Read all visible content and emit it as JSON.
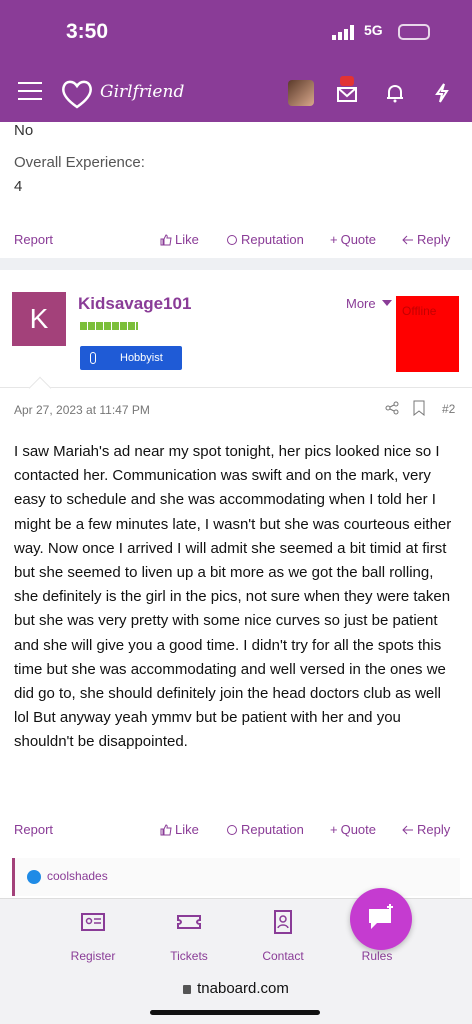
{
  "status": {
    "time": "3:50",
    "network": "5G"
  },
  "header": {
    "brand": "Girlfriend"
  },
  "prev_post": {
    "answer": "No",
    "question": "Overall Experience:",
    "rating": "4",
    "report": "Report",
    "like": "Like",
    "reputation": "Reputation",
    "quote": "Quote",
    "reply": "Reply"
  },
  "post": {
    "avatar_letter": "K",
    "username": "Kidsavage101",
    "badge": "Hobbyist",
    "more": "More",
    "status": "Offline",
    "date": "Apr 27, 2023 at 11:47 PM",
    "number": "#2",
    "body": "I saw Mariah's ad near my spot tonight, her pics looked nice so I contacted her. Communication was swift and on the mark, very easy to schedule and she was accommodating when I told her I might be a few minutes late, I wasn't but she was courteous either way. Now once I arrived I will admit she seemed a bit timid at first but she seemed to liven up a bit more as we got the ball rolling, she definitely is the girl in the pics, not sure when they were taken but she was very pretty with some nice curves so just be patient and she will give you a good time. I didn't try for all the spots this time but she was accommodating and well versed in the ones we did go to, she should definitely join the head doctors club as well lol But anyway yeah ymmv but be patient with her and you shouldn't be disappointed.",
    "report": "Report",
    "like": "Like",
    "reputation": "Reputation",
    "quote": "Quote",
    "reply": "Reply",
    "reaction_user": "coolshades"
  },
  "bottom_nav": {
    "register": "Register",
    "tickets": "Tickets",
    "contact": "Contact",
    "rules": "Rules"
  },
  "browser": {
    "url": "tnaboard.com"
  },
  "colors": {
    "brand": "#8a3c97",
    "avatar": "#a3417a",
    "offline": "#ff0000",
    "badge": "#1f5bd6",
    "fab": "#c53bd0"
  }
}
